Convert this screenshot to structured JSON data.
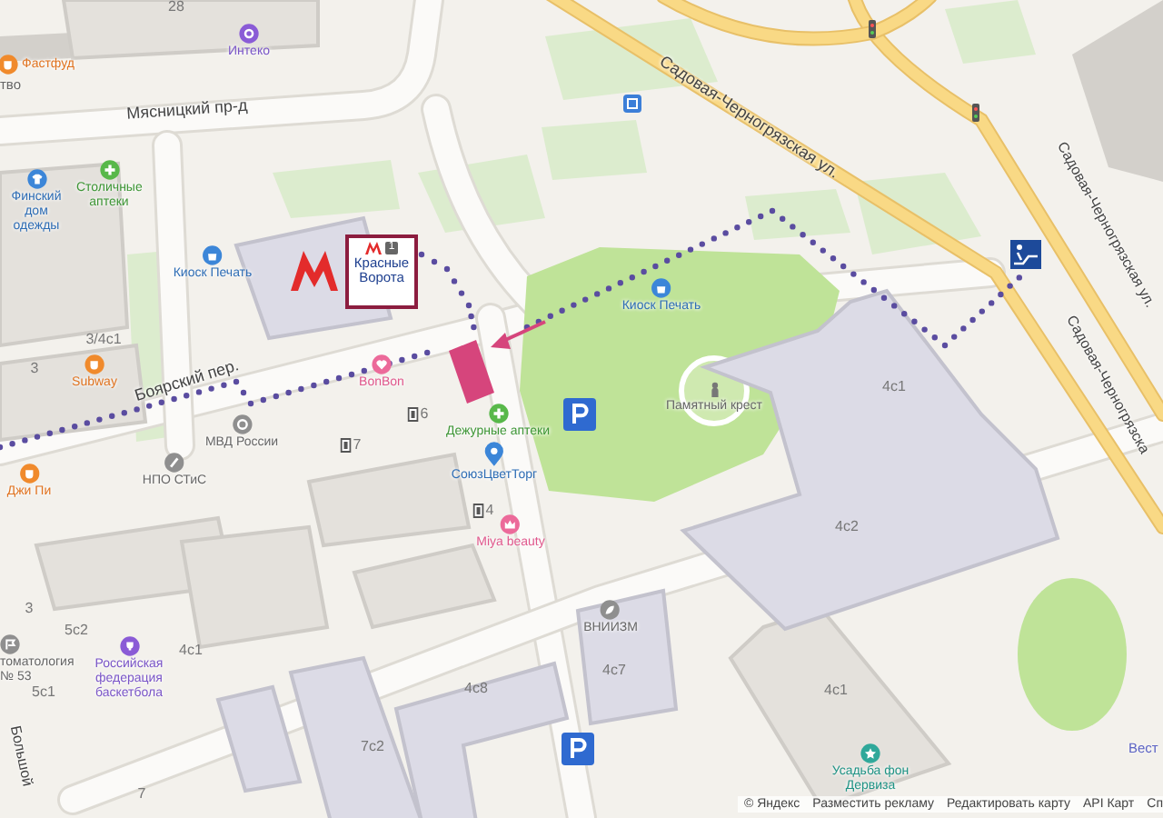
{
  "map": {
    "streets": [
      "Мясницкий пр-д",
      "Боярский пер.",
      "Садовая-Черногрязская ул.",
      "Садовая-Черногрязская ул.",
      "Садовая-Черногрязска",
      "Большой"
    ],
    "metro_station": {
      "name": "Красные Ворота",
      "line": "1"
    },
    "places": [
      {
        "name": "Интеко",
        "kind": "store"
      },
      {
        "name": "Фастфуд",
        "kind": "food"
      },
      {
        "name": "Финский дом одежды",
        "kind": "clothing"
      },
      {
        "name": "Столичные аптеки",
        "kind": "pharmacy"
      },
      {
        "name": "Киоск Печать",
        "kind": "kiosk"
      },
      {
        "name": "Subway",
        "kind": "food"
      },
      {
        "name": "BonBon",
        "kind": "sweets"
      },
      {
        "name": "МВД России",
        "kind": "government"
      },
      {
        "name": "Дежурные аптеки",
        "kind": "pharmacy"
      },
      {
        "name": "НПО СТиС",
        "kind": "office"
      },
      {
        "name": "СоюзЦветТорг",
        "kind": "flowers"
      },
      {
        "name": "Джи Пи",
        "kind": "food"
      },
      {
        "name": "Miya beauty",
        "kind": "beauty"
      },
      {
        "name": "Киоск Печать",
        "kind": "kiosk"
      },
      {
        "name": "Памятный крест",
        "kind": "monument"
      },
      {
        "name": "томатология № 53",
        "kind": "clinic"
      },
      {
        "name": "Российская федерация баскетбола",
        "kind": "sport"
      },
      {
        "name": "ВНИИЗМ",
        "kind": "research"
      },
      {
        "name": "Усадьба фон Дервиза",
        "kind": "landmark"
      }
    ],
    "building_numbers": [
      {
        "text": "28",
        "kind": "building"
      },
      {
        "text": "3/4с1",
        "kind": "building"
      },
      {
        "text": "3",
        "kind": "building"
      },
      {
        "text": "6",
        "kind": "entrance"
      },
      {
        "text": "7",
        "kind": "entrance"
      },
      {
        "text": "4",
        "kind": "entrance"
      },
      {
        "text": "4с1",
        "kind": "building"
      },
      {
        "text": "4с2",
        "kind": "building"
      },
      {
        "text": "3",
        "kind": "building"
      },
      {
        "text": "5с2",
        "kind": "building"
      },
      {
        "text": "4с1",
        "kind": "building"
      },
      {
        "text": "5с1",
        "kind": "building"
      },
      {
        "text": "4с7",
        "kind": "building"
      },
      {
        "text": "4с8",
        "kind": "building"
      },
      {
        "text": "7с2",
        "kind": "building"
      },
      {
        "text": "7",
        "kind": "building"
      },
      {
        "text": "4с1",
        "kind": "building"
      }
    ],
    "cut_labels": [
      "тво",
      "Вест"
    ],
    "footer": {
      "copyright": "© Яндекс",
      "links": [
        "Разместить рекламу",
        "Редактировать карту",
        "API Карт",
        "Сп"
      ]
    }
  }
}
